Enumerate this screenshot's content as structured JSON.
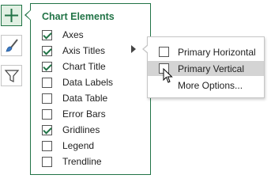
{
  "side_buttons": [
    {
      "name": "chart-elements-icon"
    },
    {
      "name": "chart-styles-brush-icon"
    },
    {
      "name": "chart-filters-funnel-icon"
    }
  ],
  "panel": {
    "title": "Chart Elements",
    "items": [
      {
        "label": "Axes",
        "checked": true
      },
      {
        "label": "Axis Titles",
        "checked": true
      },
      {
        "label": "Chart Title",
        "checked": true
      },
      {
        "label": "Data Labels",
        "checked": false
      },
      {
        "label": "Data Table",
        "checked": false
      },
      {
        "label": "Error Bars",
        "checked": false
      },
      {
        "label": "Gridlines",
        "checked": true
      },
      {
        "label": "Legend",
        "checked": false
      },
      {
        "label": "Trendline",
        "checked": false
      }
    ]
  },
  "submenu": {
    "items": [
      {
        "label": "Primary Horizontal",
        "checked": false
      },
      {
        "label": "Primary Vertical",
        "checked": false,
        "hover": true
      },
      {
        "label": "More Options..."
      }
    ]
  },
  "colors": {
    "accent": "#217346",
    "hover": "#d4d4d4"
  }
}
